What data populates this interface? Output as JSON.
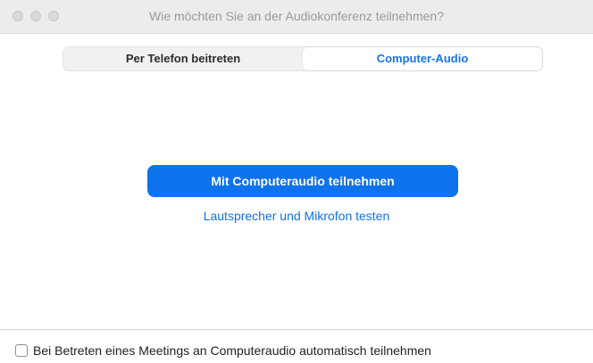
{
  "window": {
    "title": "Wie möchten Sie an der Audiokonferenz teilnehmen?"
  },
  "tabs": [
    {
      "label": "Per Telefon beitreten",
      "selected": false
    },
    {
      "label": "Computer-Audio",
      "selected": true
    }
  ],
  "main": {
    "join_button_label": "Mit Computeraudio teilnehmen",
    "test_link_label": "Lautsprecher und Mikrofon testen"
  },
  "footer": {
    "auto_join_label": "Bei Betreten eines Meetings an Computeraudio automatisch teilnehmen",
    "auto_join_checked": false
  },
  "colors": {
    "accent": "#0e72ed",
    "titlebar": "#ececec"
  }
}
